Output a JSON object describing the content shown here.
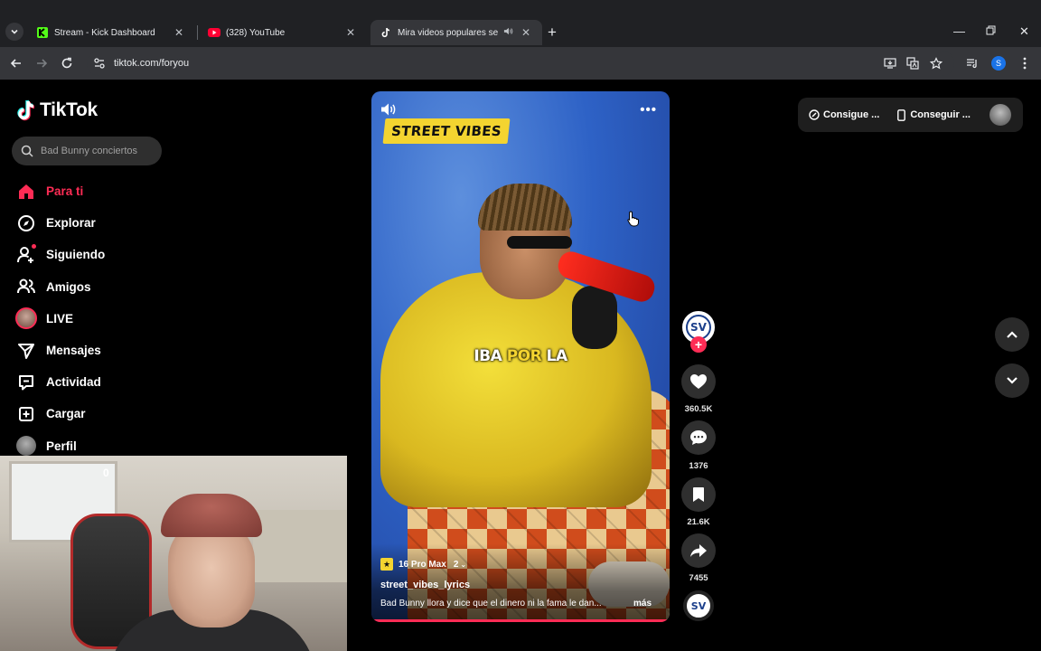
{
  "browser": {
    "tabs": [
      {
        "title": "Stream - Kick Dashboard",
        "icon": "kick-icon"
      },
      {
        "title": "(328) YouTube",
        "icon": "youtube-icon"
      },
      {
        "title": "Mira videos populares selec",
        "icon": "tiktok-icon",
        "active": true
      }
    ],
    "url": "tiktok.com/foryou",
    "profile_initial": "S"
  },
  "tiktok": {
    "logo": "TikTok",
    "search_placeholder": "Bad Bunny conciertos",
    "menu": [
      {
        "label": "Para ti",
        "icon": "home-icon",
        "active": true
      },
      {
        "label": "Explorar",
        "icon": "compass-icon"
      },
      {
        "label": "Siguiendo",
        "icon": "following-icon"
      },
      {
        "label": "Amigos",
        "icon": "friends-icon"
      },
      {
        "label": "LIVE",
        "icon": "live-avatar-icon"
      },
      {
        "label": "Mensajes",
        "icon": "send-icon"
      },
      {
        "label": "Actividad",
        "icon": "activity-icon"
      },
      {
        "label": "Cargar",
        "icon": "upload-icon"
      },
      {
        "label": "Perfil",
        "icon": "profile-avatar-icon"
      }
    ],
    "top_right": {
      "coins_label": "Consigue ...",
      "app_label": "Conseguir ..."
    }
  },
  "video": {
    "badge": "STREET VIBES",
    "caption_part1": "IBA",
    "caption_highlight": "POR",
    "caption_part2": "LA",
    "tag_label": "16 Pro Max",
    "tag_count": "2",
    "username": "street_vibes_lyrics",
    "description": "Bad Bunny llora y dice que el dinero ni la fama le dan...",
    "more_label": "más",
    "progress": 1.0,
    "avatar_text": "SV"
  },
  "actions": {
    "likes": "360.5K",
    "comments": "1376",
    "saves": "21.6K",
    "shares": "7455"
  },
  "webcam": {
    "overlay_digit": "0"
  },
  "colors": {
    "accent": "#fe2c55",
    "badge_yellow": "#f4d430"
  }
}
